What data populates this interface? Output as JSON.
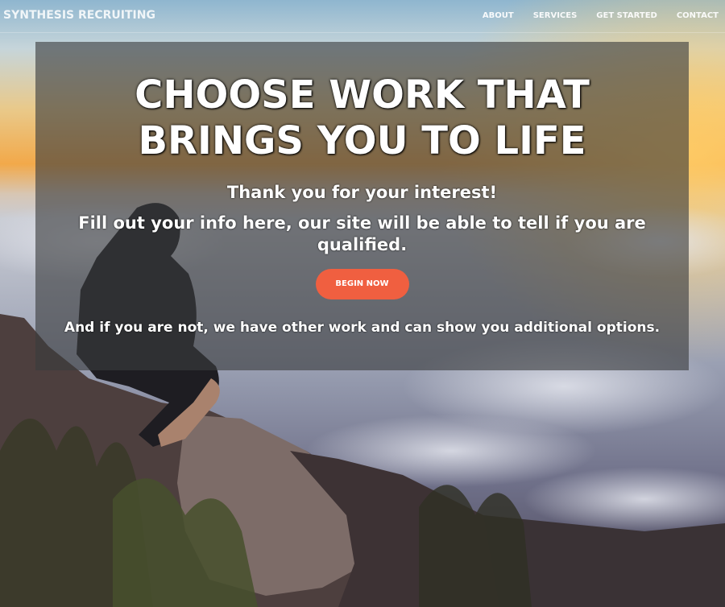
{
  "brand": "SYNTHESIS RECRUITING",
  "nav": {
    "about": "ABOUT",
    "services": "SERVICES",
    "get_started": "GET STARTED",
    "contact": "CONTACT"
  },
  "hero": {
    "headline_line1": "CHOOSE WORK THAT",
    "headline_line2": "BRINGS YOU TO LIFE",
    "thanks": "Thank you for your interest!",
    "instructions": "Fill out your info here, our site will be able to tell if you are qualified.",
    "cta_label": "BEGIN NOW",
    "footnote": "And if you are not, we have other work and can show you additional options."
  },
  "colors": {
    "accent": "#f05f40",
    "overlay": "#3a3c3e"
  }
}
